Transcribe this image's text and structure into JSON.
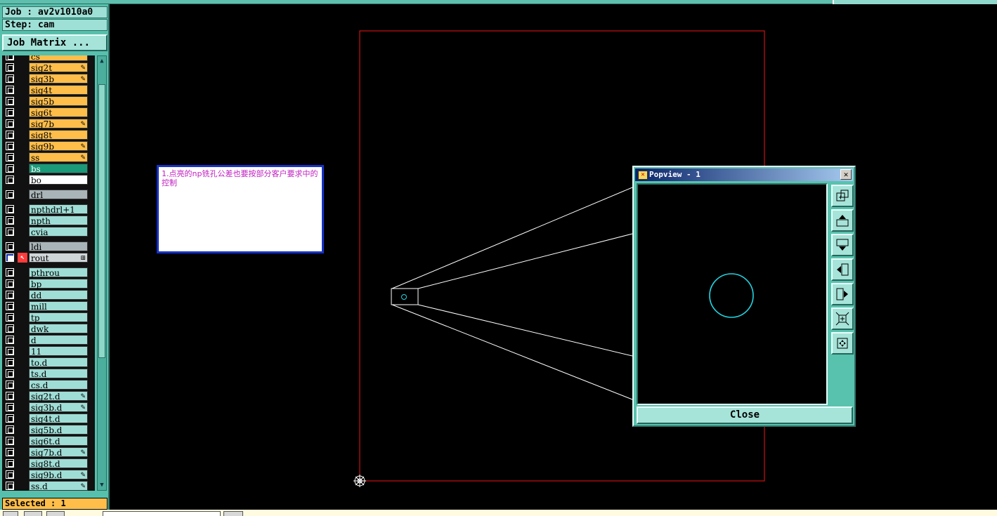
{
  "job": {
    "label": "Job : av2v1010a0"
  },
  "step": {
    "label": "Step: cam"
  },
  "job_matrix_button": "Job Matrix ...",
  "layers": [
    {
      "name": "cs",
      "color": "orange",
      "edit": false
    },
    {
      "name": "sig2t",
      "color": "orange",
      "edit": true
    },
    {
      "name": "sig3b",
      "color": "orange",
      "edit": true
    },
    {
      "name": "sig4t",
      "color": "orange",
      "edit": false
    },
    {
      "name": "sig5b",
      "color": "orange",
      "edit": false
    },
    {
      "name": "sig6t",
      "color": "orange",
      "edit": false
    },
    {
      "name": "sig7b",
      "color": "orange",
      "edit": true
    },
    {
      "name": "sig8t",
      "color": "orange",
      "edit": false
    },
    {
      "name": "sig9b",
      "color": "orange",
      "edit": true
    },
    {
      "name": "ss",
      "color": "orange",
      "edit": true
    },
    {
      "name": "bs",
      "color": "green",
      "edit": false
    },
    {
      "name": "bo",
      "color": "white",
      "edit": false
    },
    {
      "name": "drl",
      "color": "gray",
      "edit": false,
      "gap": true
    },
    {
      "name": "npthdrl+1",
      "color": "teal",
      "edit": false,
      "gap": true
    },
    {
      "name": "npth",
      "color": "teal",
      "edit": false
    },
    {
      "name": "cvia",
      "color": "teal",
      "edit": false
    },
    {
      "name": "ldi",
      "color": "gray",
      "edit": false,
      "gap": true
    },
    {
      "name": "rout",
      "color": "lgray",
      "edit": false,
      "active": true
    },
    {
      "name": "pthrou",
      "color": "teal",
      "edit": false,
      "gap": true
    },
    {
      "name": "bp",
      "color": "teal",
      "edit": false
    },
    {
      "name": "dd",
      "color": "teal",
      "edit": false
    },
    {
      "name": "mill",
      "color": "teal",
      "edit": false
    },
    {
      "name": "tp",
      "color": "teal",
      "edit": false
    },
    {
      "name": "dwk",
      "color": "teal",
      "edit": false
    },
    {
      "name": "d",
      "color": "teal",
      "edit": false
    },
    {
      "name": "11",
      "color": "teal",
      "edit": false
    },
    {
      "name": "to.d",
      "color": "teal",
      "edit": false
    },
    {
      "name": "ts.d",
      "color": "teal",
      "edit": false
    },
    {
      "name": "cs.d",
      "color": "teal",
      "edit": false
    },
    {
      "name": "sig2t.d",
      "color": "teal",
      "edit": true
    },
    {
      "name": "sig3b.d",
      "color": "teal",
      "edit": true
    },
    {
      "name": "sig4t.d",
      "color": "teal",
      "edit": false
    },
    {
      "name": "sig5b.d",
      "color": "teal",
      "edit": false
    },
    {
      "name": "sig6t.d",
      "color": "teal",
      "edit": false
    },
    {
      "name": "sig7b.d",
      "color": "teal",
      "edit": true
    },
    {
      "name": "sig8t.d",
      "color": "teal",
      "edit": false
    },
    {
      "name": "sig9b.d",
      "color": "teal",
      "edit": true
    },
    {
      "name": "ss.d",
      "color": "teal",
      "edit": true
    }
  ],
  "selected": {
    "label": "Selected : 1"
  },
  "note": {
    "text": "1.点亮的np铣孔公差也要按部分客户要求中的控制"
  },
  "popview": {
    "title": "Popview - 1",
    "close_label": "Close",
    "tools": [
      "zoom-fit-icon",
      "pan-up-icon",
      "pan-down-icon",
      "pan-left-icon",
      "pan-right-icon",
      "zoom-in-icon",
      "zoom-out-icon"
    ]
  },
  "colors": {
    "profile": "#cc1111",
    "circle": "#22d3e0",
    "panel": "#57c0ad",
    "selected_bg": "#ffbe4a"
  }
}
